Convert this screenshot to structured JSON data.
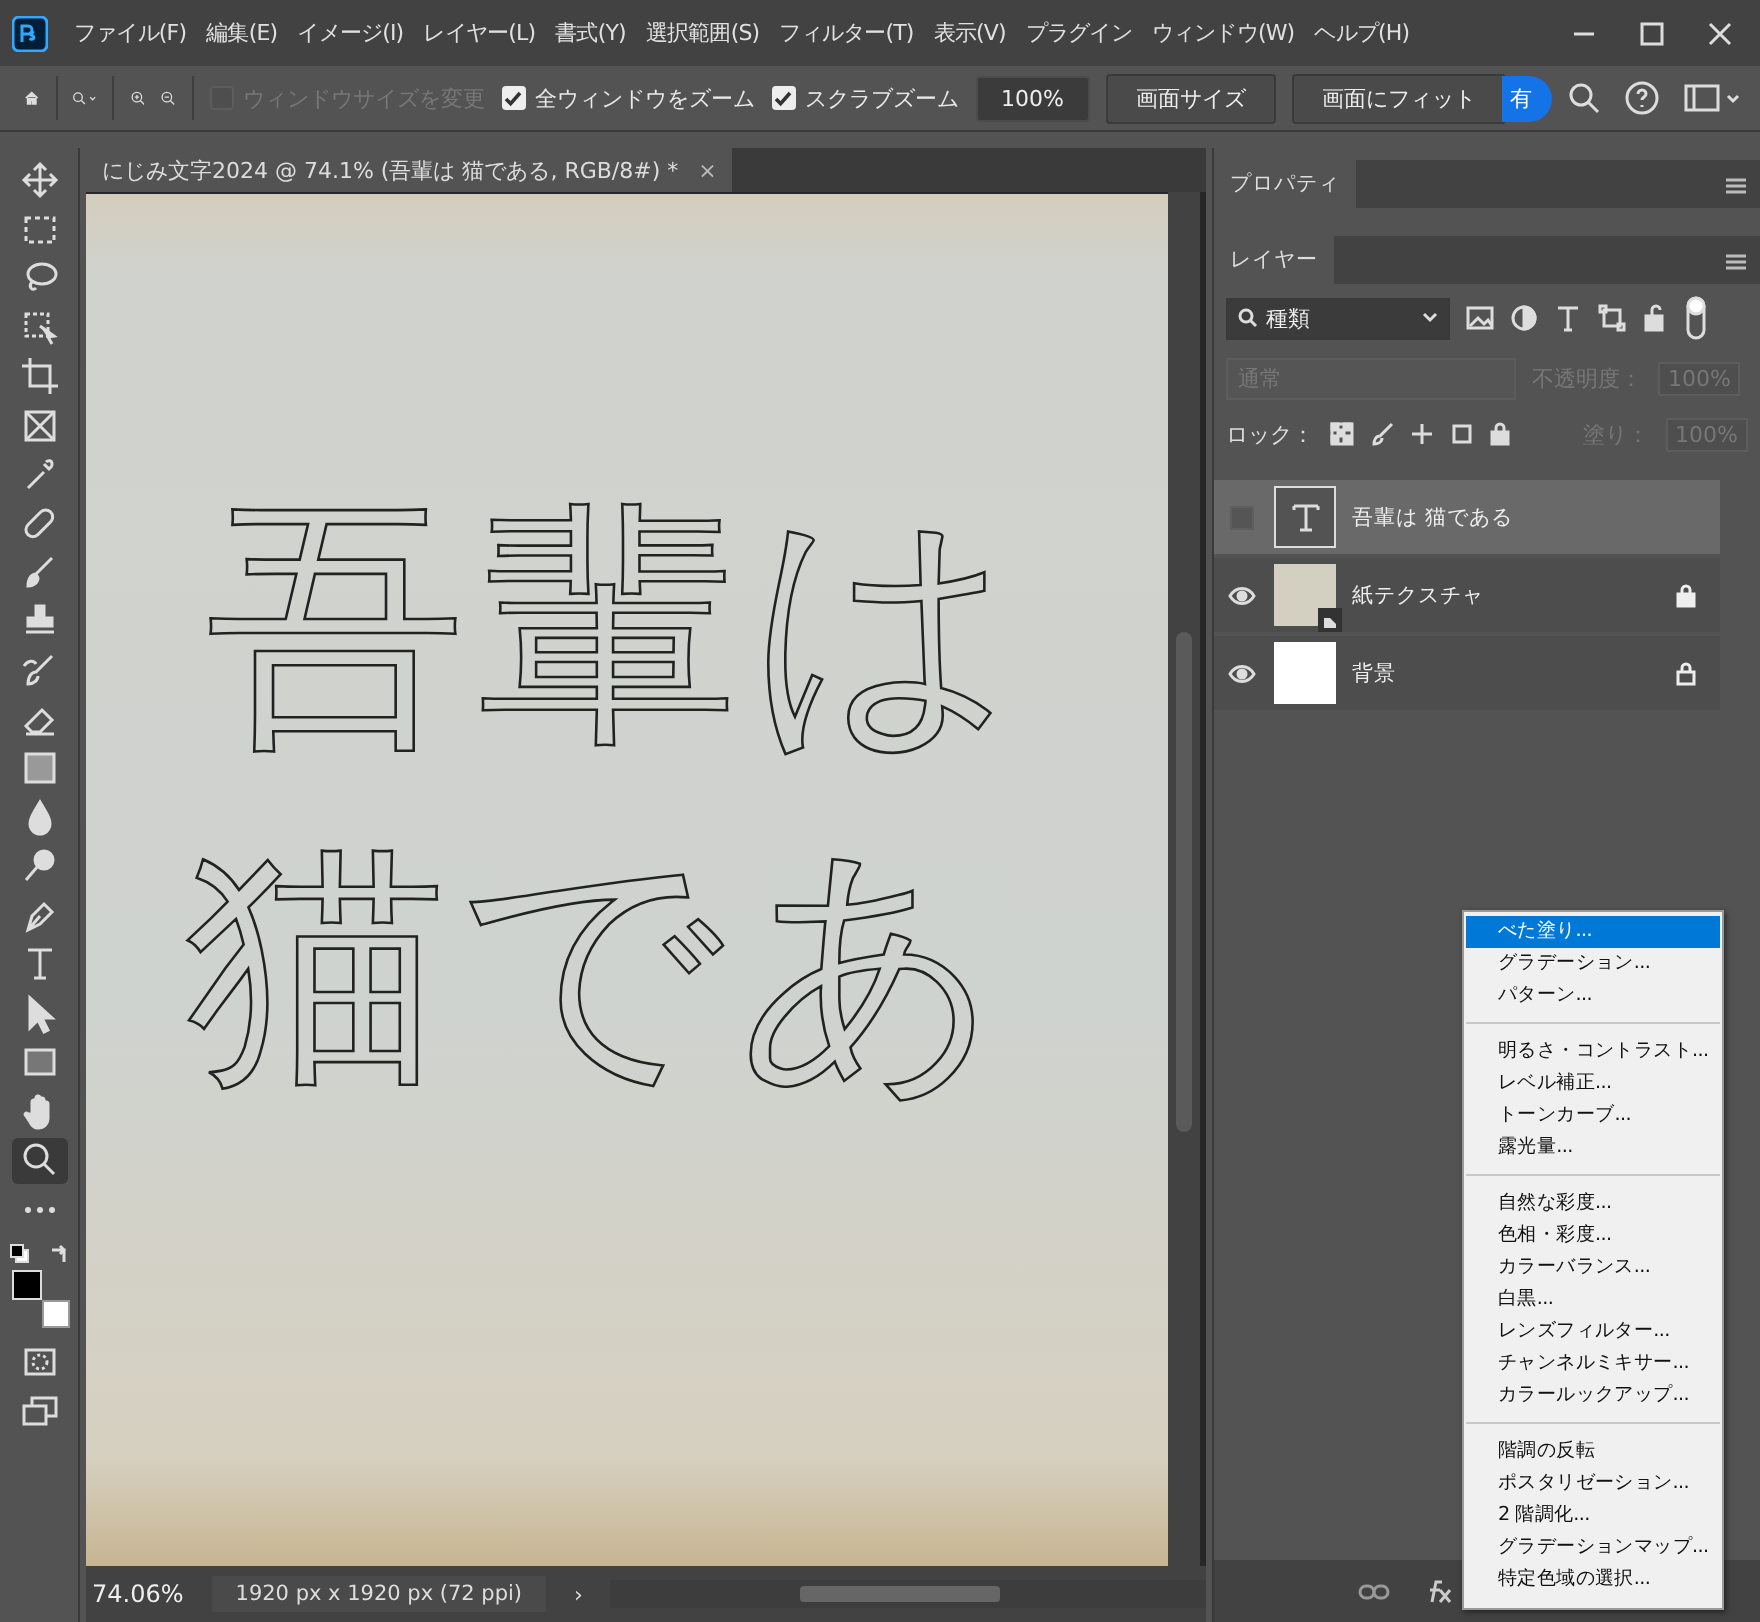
{
  "menu_bar": {
    "items": [
      "ファイル(F)",
      "編集(E)",
      "イメージ(I)",
      "レイヤー(L)",
      "書式(Y)",
      "選択範囲(S)",
      "フィルター(T)",
      "表示(V)",
      "プラグイン",
      "ウィンドウ(W)",
      "ヘルプ(H)"
    ]
  },
  "options_bar": {
    "resize_windows": {
      "label": "ウィンドウサイズを変更",
      "checked": false,
      "disabled": true
    },
    "zoom_all": {
      "label": "全ウィンドウをズーム",
      "checked": true
    },
    "scrubby_zoom": {
      "label": "スクラブズーム",
      "checked": true
    },
    "zoom_value": "100%",
    "buttons": [
      "画面サイズ",
      "画面にフィット"
    ],
    "share_button": "有"
  },
  "document_tab": {
    "title": "にじみ文字2024 @ 74.1% (吾輩は 猫である, RGB/8#) *",
    "close": "×"
  },
  "canvas": {
    "selection_lines": [
      "吾輩は",
      "猫であ"
    ]
  },
  "tools": [
    {
      "kind": "move",
      "selected": false
    },
    {
      "kind": "marquee",
      "selected": false
    },
    {
      "kind": "lasso",
      "selected": false
    },
    {
      "kind": "object",
      "selected": false
    },
    {
      "kind": "crop",
      "selected": false
    },
    {
      "kind": "frame",
      "selected": false
    },
    {
      "kind": "eyedropper",
      "selected": false
    },
    {
      "kind": "healing",
      "selected": false
    },
    {
      "kind": "brush",
      "selected": false
    },
    {
      "kind": "stamp",
      "selected": false
    },
    {
      "kind": "history",
      "selected": false
    },
    {
      "kind": "eraser",
      "selected": false
    },
    {
      "kind": "gradient",
      "selected": false
    },
    {
      "kind": "blur",
      "selected": false
    },
    {
      "kind": "dodge",
      "selected": false
    },
    {
      "kind": "pen",
      "selected": false
    },
    {
      "kind": "type",
      "selected": false
    },
    {
      "kind": "path",
      "selected": false
    },
    {
      "kind": "rectangle",
      "selected": false
    },
    {
      "kind": "hand",
      "selected": false
    },
    {
      "kind": "zoom",
      "selected": true
    },
    {
      "kind": "more",
      "selected": false
    }
  ],
  "status_bar": {
    "zoom": "74.06%",
    "doc_size": "1920 px x 1920 px (72 ppi)",
    "arrow": "›"
  },
  "properties_panel": {
    "tab": "プロパティ"
  },
  "layers_panel": {
    "tab": "レイヤー",
    "filter": "種類",
    "blend_mode": "通常",
    "opacity_label": "不透明度：",
    "opacity": "100%",
    "lock_label": "ロック：",
    "fill_label": "塗り：",
    "fill": "100%",
    "layers": [
      {
        "name": "吾輩は 猫である",
        "kind": "text",
        "visible": false,
        "selected": true,
        "locked": false
      },
      {
        "name": "紙テクスチャ",
        "kind": "smart",
        "visible": true,
        "selected": false,
        "locked": true,
        "lock_partial": true
      },
      {
        "name": "背景",
        "kind": "background",
        "visible": true,
        "selected": false,
        "locked": true,
        "lock_partial": false
      }
    ]
  },
  "adjustment_menu": {
    "groups": [
      [
        {
          "label": "べた塗り...",
          "selected": true
        },
        {
          "label": "グラデーション...",
          "selected": false
        },
        {
          "label": "パターン...",
          "selected": false
        }
      ],
      [
        {
          "label": "明るさ・コントラスト...",
          "selected": false
        },
        {
          "label": "レベル補正...",
          "selected": false
        },
        {
          "label": "トーンカーブ...",
          "selected": false
        },
        {
          "label": "露光量...",
          "selected": false
        }
      ],
      [
        {
          "label": "自然な彩度...",
          "selected": false
        },
        {
          "label": "色相・彩度...",
          "selected": false
        },
        {
          "label": "カラーバランス...",
          "selected": false
        },
        {
          "label": "白黒...",
          "selected": false
        },
        {
          "label": "レンズフィルター...",
          "selected": false
        },
        {
          "label": "チャンネルミキサー...",
          "selected": false
        },
        {
          "label": "カラールックアップ...",
          "selected": false
        }
      ],
      [
        {
          "label": "階調の反転",
          "selected": false
        },
        {
          "label": "ポスタリゼーション...",
          "selected": false
        },
        {
          "label": "2 階調化...",
          "selected": false
        },
        {
          "label": "グラデーションマップ...",
          "selected": false
        },
        {
          "label": "特定色域の選択...",
          "selected": false
        }
      ]
    ]
  }
}
